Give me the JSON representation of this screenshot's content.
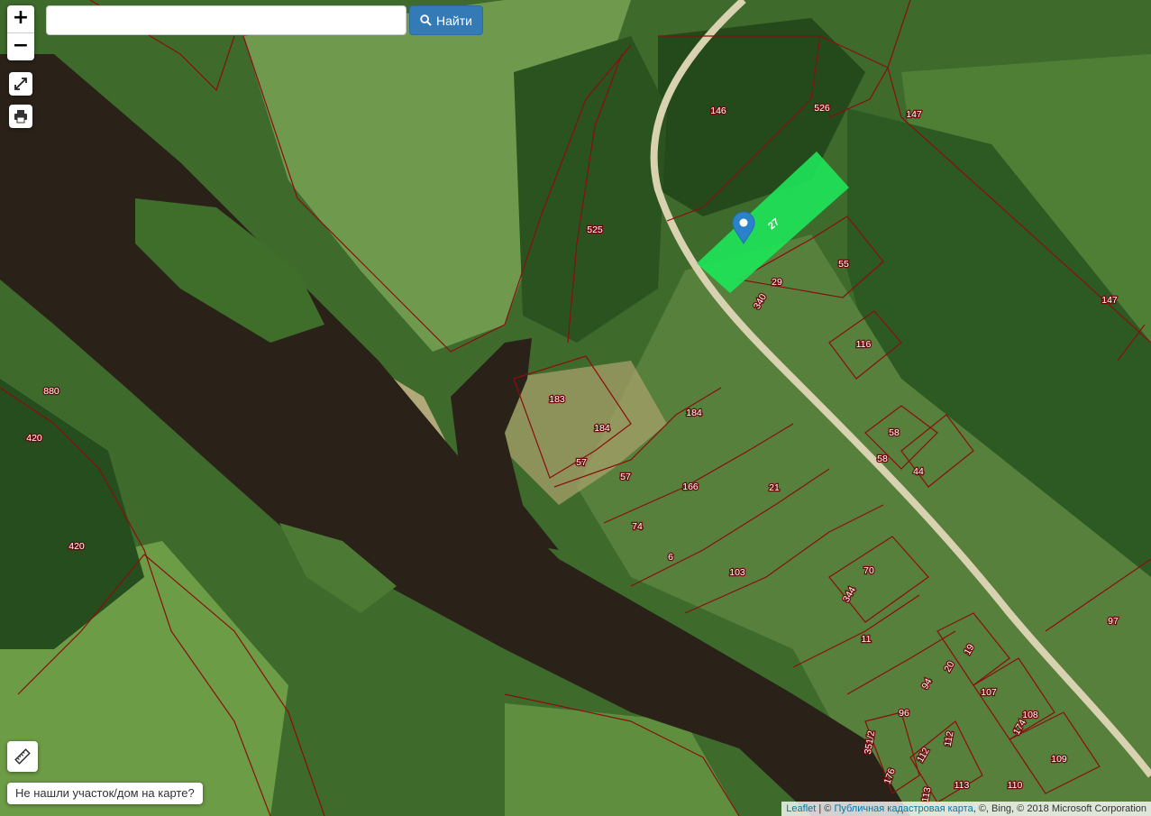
{
  "search": {
    "placeholder": "",
    "button_label": "Найти"
  },
  "zoom": {
    "in_label": "+",
    "out_label": "−"
  },
  "not_found_label": "Не нашли участок/дом на карте?",
  "attribution": {
    "leaflet": "Leaflet",
    "sep1": " | © ",
    "pkk": "Публичная кадастровая карта",
    "rest": ", ©, Bing, © 2018 Microsoft Corporation"
  },
  "selected_parcel_label": "27",
  "parcel_labels": [
    "146",
    "526",
    "147",
    "525",
    "55",
    "29",
    "340",
    "116",
    "183",
    "184",
    "57",
    "184",
    "57",
    "166",
    "21",
    "58",
    "58",
    "44",
    "74",
    "6",
    "103",
    "70",
    "344",
    "11",
    "19",
    "20",
    "107",
    "96",
    "94",
    "108",
    "174",
    "109",
    "351/2",
    "112",
    "112",
    "113",
    "113",
    "110",
    "176",
    "97",
    "147",
    "880",
    "420",
    "420"
  ],
  "colors": {
    "parcel_border": "#8b0e0e",
    "selected_fill": "#1ee65a",
    "river": "#2b2217",
    "button_blue": "#337ab7"
  },
  "icons": [
    "fullscreen-icon",
    "print-icon",
    "ruler-icon",
    "search-icon",
    "marker-icon"
  ]
}
